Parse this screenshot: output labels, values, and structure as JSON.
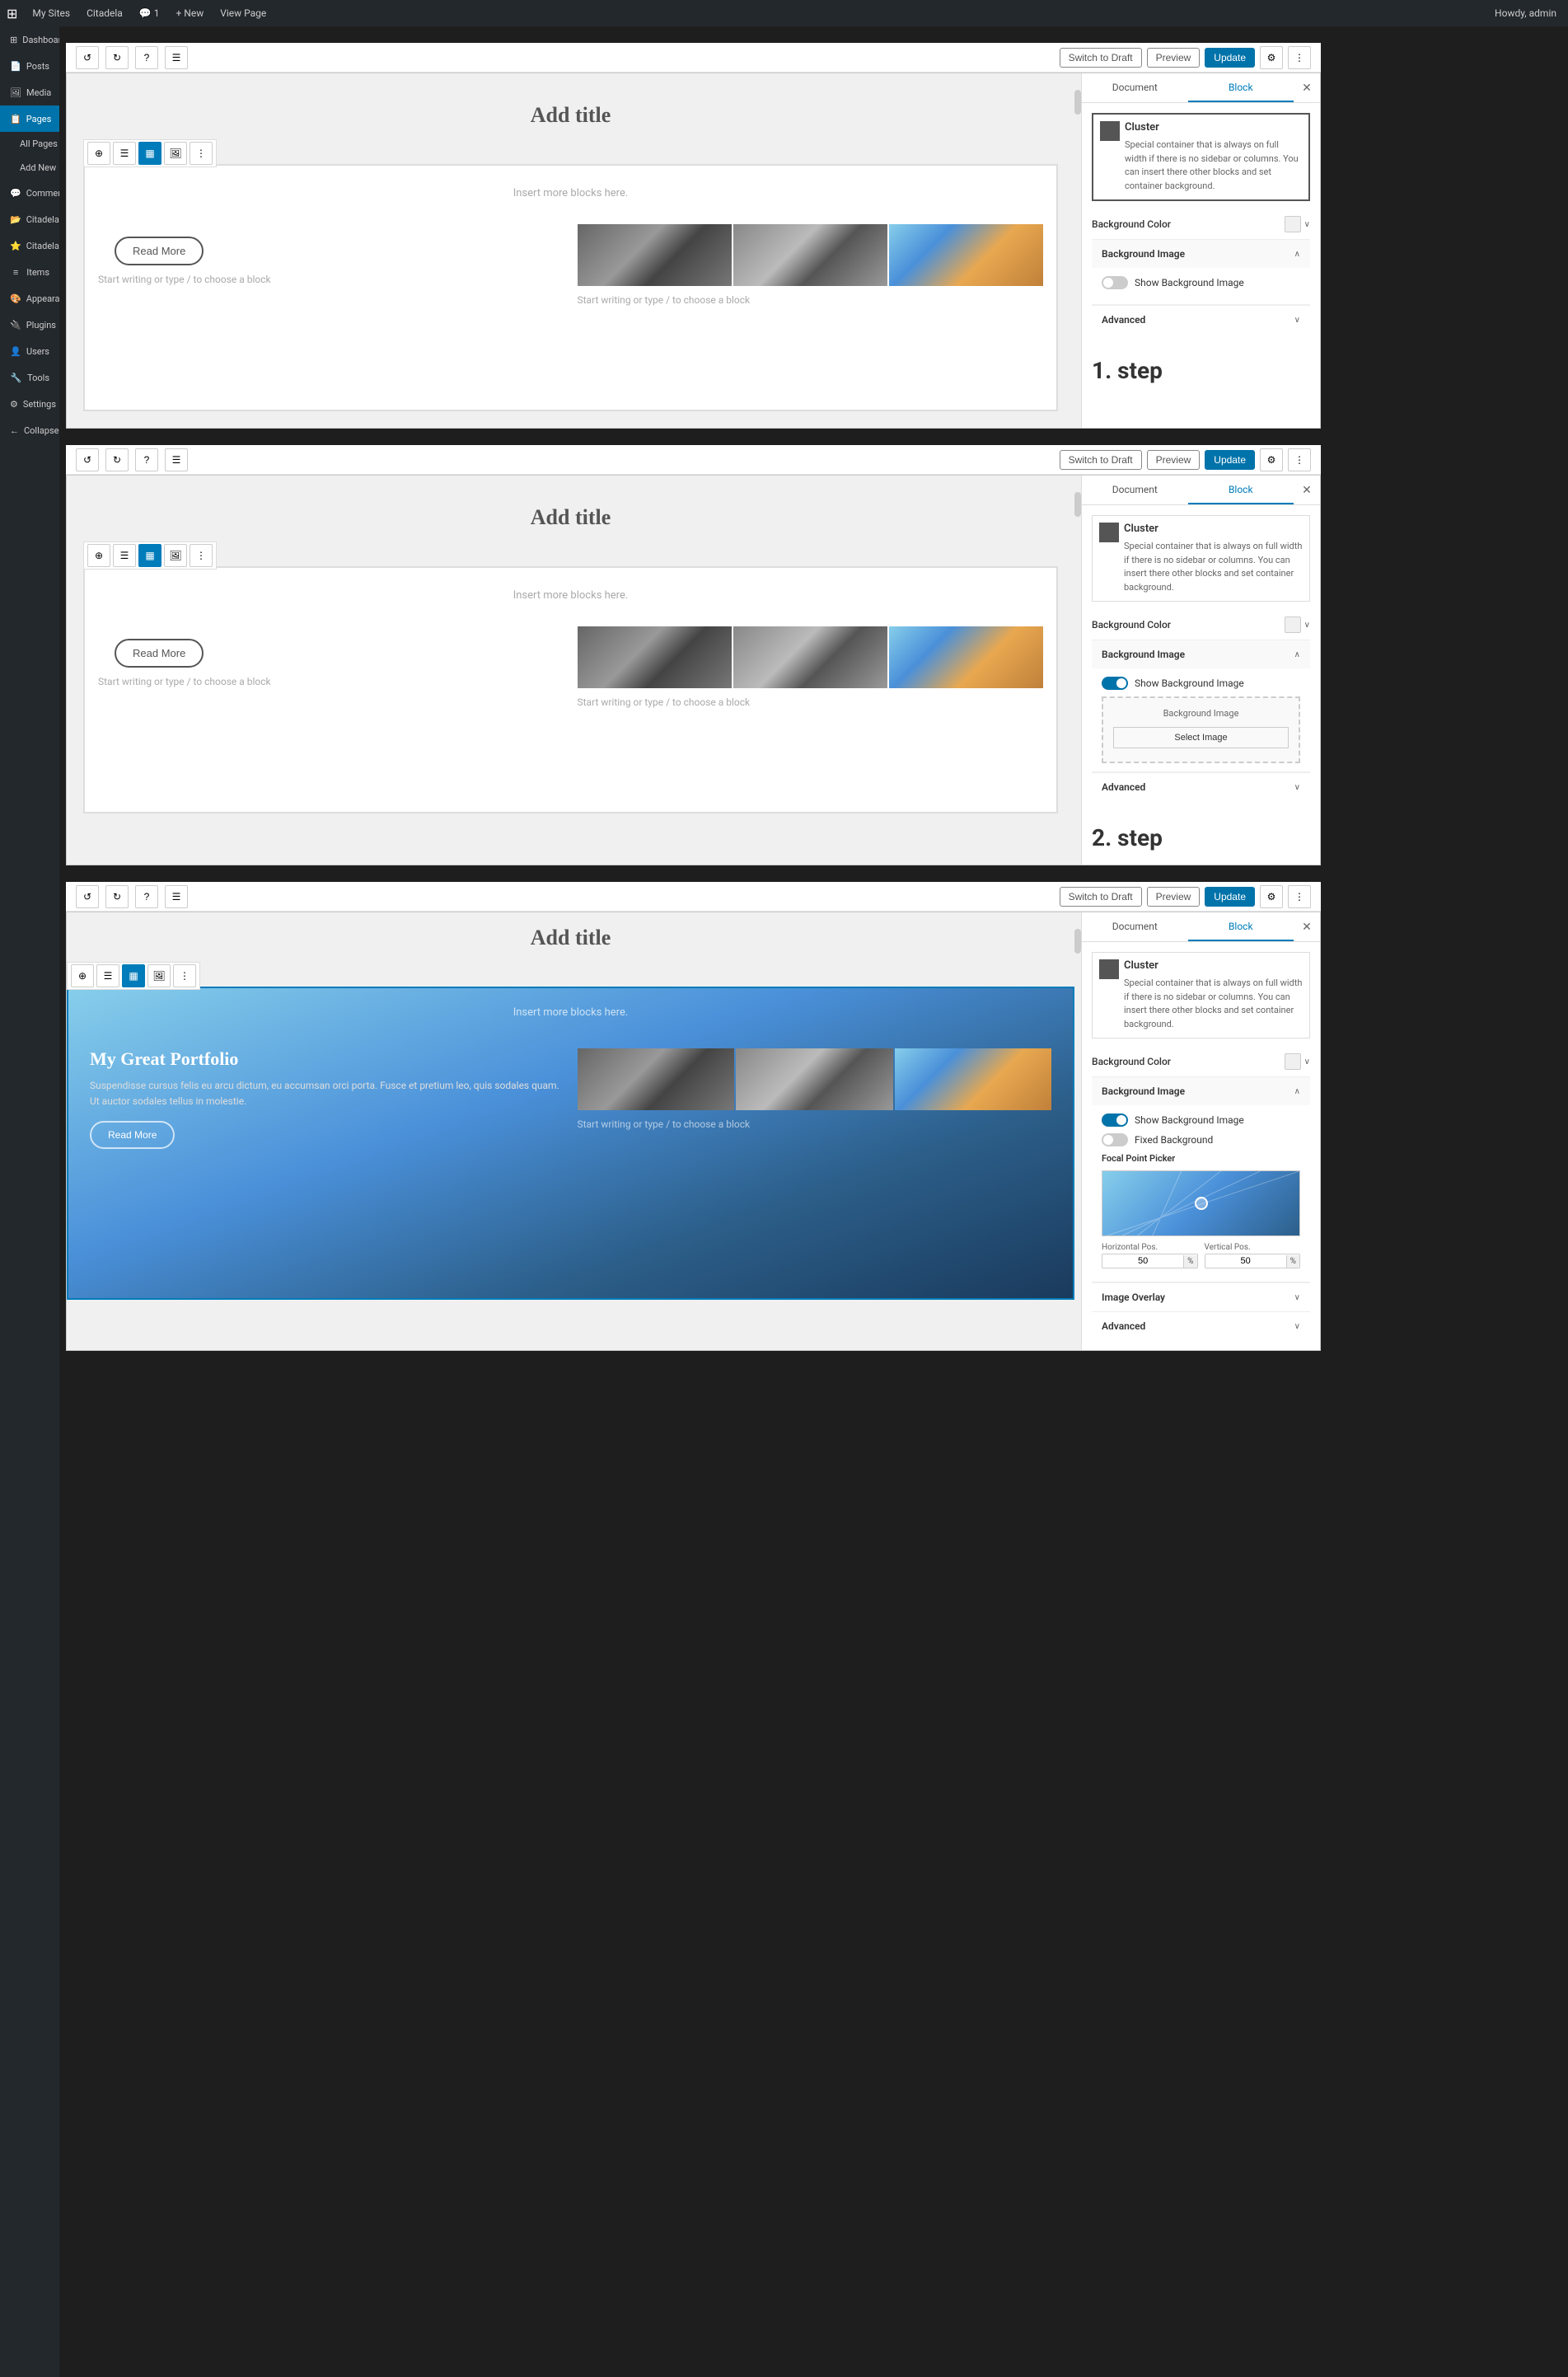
{
  "adminBar": {
    "items": [
      "My Sites",
      "Citadela",
      "1",
      "New",
      "View Page",
      "Howdy, admin"
    ]
  },
  "sidebar": {
    "items": [
      {
        "label": "Dashboard",
        "icon": "⊞"
      },
      {
        "label": "Posts",
        "icon": "📄"
      },
      {
        "label": "Media",
        "icon": "🖼"
      },
      {
        "label": "Pages",
        "icon": "📋",
        "active": true
      },
      {
        "label": "All Pages",
        "sub": true
      },
      {
        "label": "Add New",
        "sub": true
      },
      {
        "label": "Comments",
        "icon": "💬"
      },
      {
        "label": "Citadela Directory",
        "icon": "📂"
      },
      {
        "label": "Citadela Pro",
        "icon": "⭐"
      },
      {
        "label": "Items",
        "icon": "≡"
      },
      {
        "label": "Appearance",
        "icon": "🎨"
      },
      {
        "label": "Plugins",
        "icon": "🔌"
      },
      {
        "label": "Users",
        "icon": "👤"
      },
      {
        "label": "Tools",
        "icon": "🔧"
      },
      {
        "label": "Settings",
        "icon": "⚙"
      },
      {
        "label": "Collapse menu",
        "icon": "←"
      }
    ]
  },
  "sections": [
    {
      "id": "section1",
      "editorTitle": "Add title",
      "insertMoreText": "Insert more blocks here.",
      "readMoreLabel": "Read More",
      "startWritingText": "Start writing or type / to choose a block",
      "startWritingText2": "Start writing or type / to choose a block",
      "topbarButtons": {
        "switchToDraft": "Switch to Draft",
        "preview": "Preview",
        "update": "Update"
      },
      "panel": {
        "tabs": [
          "Document",
          "Block"
        ],
        "activeTab": "Block",
        "clusterTitle": "Cluster",
        "clusterDesc": "Special container that is always on full width if there is no sidebar or columns. You can insert there other blocks and set container background.",
        "bgColorLabel": "Background Color",
        "bgImageLabel": "Background Image",
        "bgImageSection": {
          "open": true,
          "showBgLabel": "Show Background Image",
          "toggleOn": false
        },
        "advancedLabel": "Advanced"
      },
      "stepLabel": "1. step"
    },
    {
      "id": "section2",
      "editorTitle": "Add title",
      "insertMoreText": "Insert more blocks here.",
      "readMoreLabel": "Read More",
      "startWritingText": "Start writing or type / to choose a block",
      "startWritingText2": "Start writing or type / to choose a block",
      "topbarButtons": {
        "switchToDraft": "Switch to Draft",
        "preview": "Preview",
        "update": "Update"
      },
      "panel": {
        "tabs": [
          "Document",
          "Block"
        ],
        "activeTab": "Block",
        "clusterTitle": "Cluster",
        "clusterDesc": "Special container that is always on full width if there is no sidebar or columns. You can insert there other blocks and set container background.",
        "bgColorLabel": "Background Color",
        "bgImageLabel": "Background Image",
        "bgImageSection": {
          "open": true,
          "showBgLabel": "Show Background Image",
          "toggleOn": true,
          "bgImageText": "Background Image",
          "selectImageText": "Select Image"
        },
        "advancedLabel": "Advanced"
      },
      "stepLabel": "2. step"
    },
    {
      "id": "section3",
      "editorTitle": "Add title",
      "insertMoreText": "Insert more blocks here.",
      "portfolioTitle": "My Great Portfolio",
      "portfolioText": "Suspendisse cursus felis eu arcu dictum, eu accumsan orci porta. Fusce et pretium leo, quis sodales quam. Ut auctor sodales tellus in molestie.",
      "readMoreLabel": "Read More",
      "startWritingText": "Start writing or type / to choose a block",
      "topbarButtons": {
        "switchToDraft": "Switch to Draft",
        "preview": "Preview",
        "update": "Update"
      },
      "panel": {
        "tabs": [
          "Document",
          "Block"
        ],
        "activeTab": "Block",
        "clusterTitle": "Cluster",
        "clusterDesc": "Special container that is always on full width if there is no sidebar or columns. You can insert there other blocks and set container background.",
        "bgColorLabel": "Background Color",
        "bgImageLabel": "Background Image",
        "bgImageSection": {
          "open": true,
          "showBgLabel": "Show Background Image",
          "toggleOn": true,
          "fixedBgLabel": "Fixed Background",
          "fixedBgOn": false,
          "focalPointLabel": "Focal Point Picker",
          "horizLabel": "Horizontal Pos.",
          "vertLabel": "Vertical Pos.",
          "horizValue": "50",
          "vertValue": "50",
          "horizUnit": "%",
          "vertUnit": "%"
        },
        "imageOverlayLabel": "Image Overlay",
        "advancedLabel": "Advanced"
      }
    }
  ],
  "colors": {
    "blue": "#0073aa",
    "darkBg": "#1e1e1e",
    "sidebar": "#23282d",
    "activeBlue": "#007cba"
  }
}
